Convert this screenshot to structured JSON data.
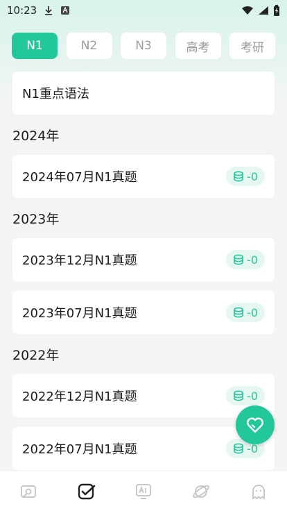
{
  "status_bar": {
    "time": "10:23"
  },
  "tabs": [
    {
      "label": "N1",
      "active": true
    },
    {
      "label": "N2",
      "active": false
    },
    {
      "label": "N3",
      "active": false
    },
    {
      "label": "高考",
      "active": false
    },
    {
      "label": "考研",
      "active": false
    }
  ],
  "highlight_card": {
    "title": "N1重点语法"
  },
  "sections": [
    {
      "year": "2024年",
      "items": [
        {
          "title": "2024年07月N1真题",
          "badge": "-0"
        }
      ]
    },
    {
      "year": "2023年",
      "items": [
        {
          "title": "2023年12月N1真题",
          "badge": "-0"
        },
        {
          "title": "2023年07月N1真题",
          "badge": "-0"
        }
      ]
    },
    {
      "year": "2022年",
      "items": [
        {
          "title": "2022年12月N1真题",
          "badge": "-0"
        },
        {
          "title": "2022年07月N1真题",
          "badge": "-0"
        }
      ]
    }
  ],
  "colors": {
    "accent": "#22c79a",
    "badge_bg": "#e6f7f1",
    "inactive_tab_text": "#9a9a9a"
  },
  "icons": {
    "bottom_nav": [
      "photo-icon",
      "check-icon",
      "ai-icon",
      "planet-icon",
      "ghost-icon"
    ],
    "fab": "heart-icon"
  }
}
